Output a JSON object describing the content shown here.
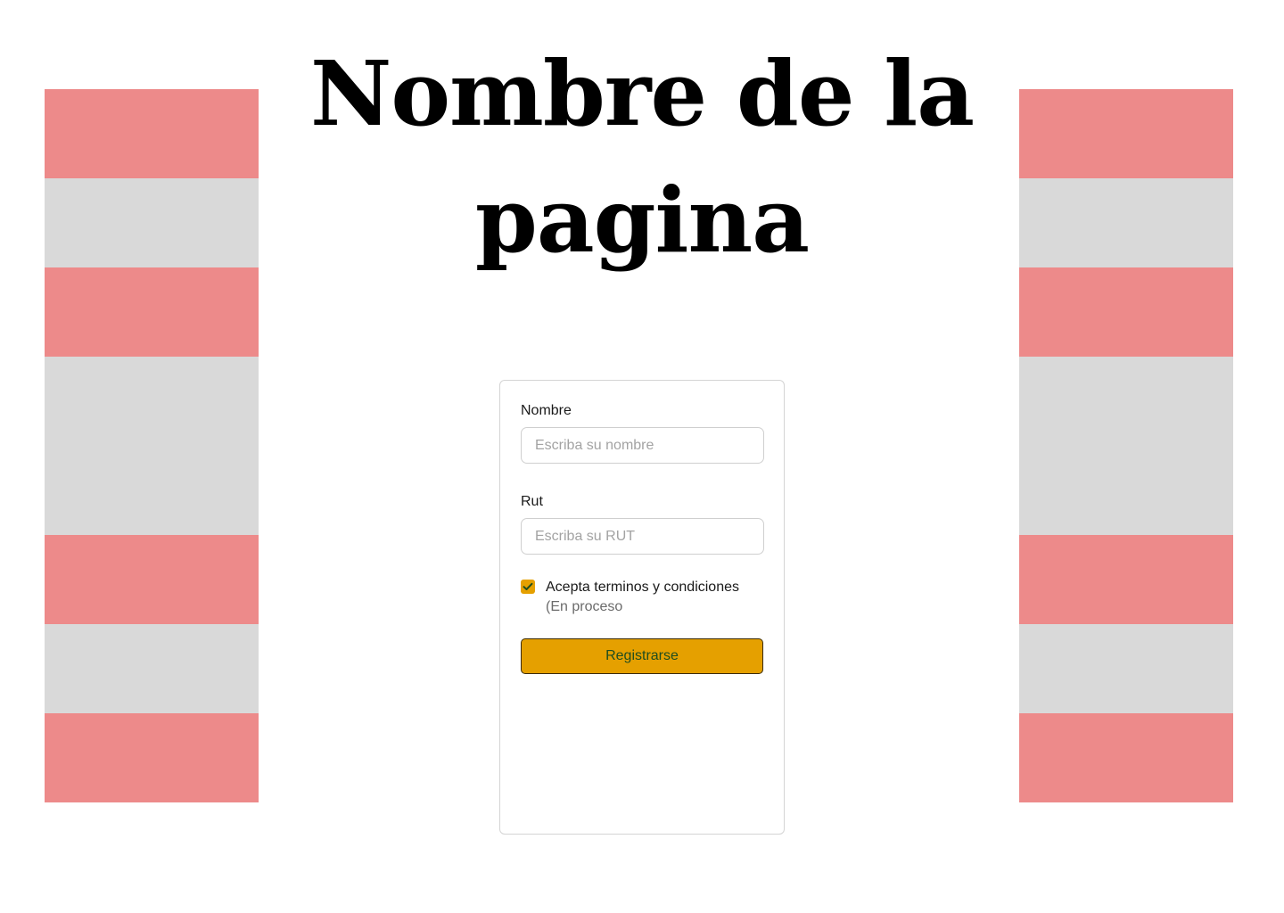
{
  "page": {
    "title": "Nombre de la pagina"
  },
  "decor": {
    "stripe_colors": {
      "pink": "#ed8a8a",
      "gray": "#d9d9d9"
    }
  },
  "form": {
    "name_label": "Nombre",
    "name_placeholder": "Escriba su nombre",
    "name_value": "",
    "rut_label": "Rut",
    "rut_placeholder": "Escriba su RUT",
    "rut_value": "",
    "terms_checked": true,
    "terms_label": "Acepta terminos y condiciones",
    "terms_status": "(En proceso",
    "submit_label": "Registrarse",
    "accent_color": "#e5a000",
    "submit_text_color": "#1f4d1f"
  }
}
